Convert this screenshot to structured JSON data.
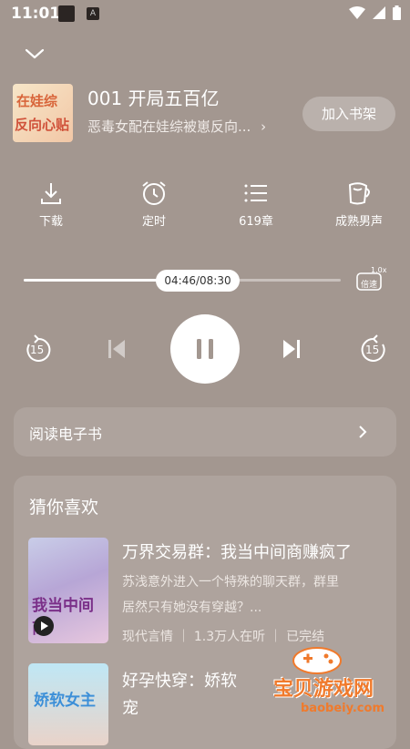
{
  "status_bar": {
    "time": "11:01",
    "notif_icon_letter": "A"
  },
  "book": {
    "cover_title_line1": "在娃综",
    "cover_title_line2": "反向心贴",
    "chapter_title": "001 开局五百亿",
    "book_name": "恶毒女配在娃综被崽反向...",
    "add_shelf_label": "加入书架"
  },
  "functions": [
    {
      "label": "下载",
      "icon": "download-icon"
    },
    {
      "label": "定时",
      "icon": "alarm-icon"
    },
    {
      "label": "619章",
      "icon": "chapter-list-icon"
    },
    {
      "label": "成熟男声",
      "icon": "voice-icon"
    }
  ],
  "progress": {
    "time_text": "04:46/08:30",
    "fraction": 0.561,
    "speed_label": "倍速",
    "speed_value": "1.0x"
  },
  "controls": {
    "rewind_seconds": "15",
    "forward_seconds": "15"
  },
  "read_ebook": {
    "label": "阅读电子书"
  },
  "recommend": {
    "title": "猜你喜欢",
    "items": [
      {
        "cover_text": "我当中间商",
        "title": "万界交易群：我当中间商赚疯了",
        "desc_line1": "苏浅意外进入一个特殊的聊天群，群里",
        "desc_line2": "居然只有她没有穿越？...",
        "meta": "现代言情 ｜ 1.3万人在听 ｜ 已完结"
      },
      {
        "cover_text": "娇软女主",
        "title_line1": "好孕快穿：娇软",
        "title_line2": "宠"
      }
    ]
  },
  "watermark": {
    "text": "宝贝游戏网",
    "url": "baobeiy.com"
  },
  "colors": {
    "background": "#a39790",
    "accent": "#ffffff",
    "watermark": "#f07a2c"
  }
}
